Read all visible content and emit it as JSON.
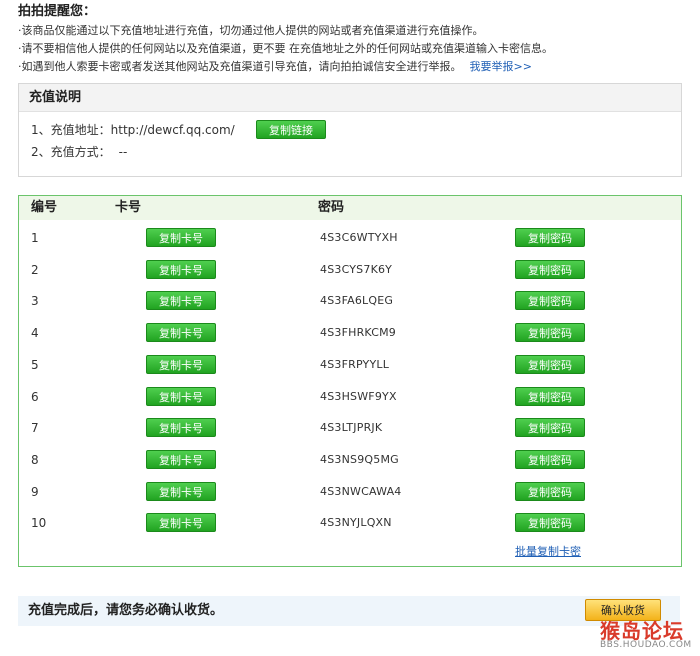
{
  "notice": {
    "title": "拍拍提醒您：",
    "lines": [
      "·该商品仅能通过以下充值地址进行充值，切勿通过他人提供的网站或者充值渠道进行充值操作。",
      "·请不要相信他人提供的任何网站以及充值渠道，更不要 在充值地址之外的任何网站或充值渠道输入卡密信息。",
      "·如遇到他人索要卡密或者发送其他网站及充值渠道引导充值，请向拍拍诚信安全进行举报。"
    ],
    "report_link": "我要举报>>"
  },
  "recharge_info": {
    "title": "充值说明",
    "address_label": "1、充值地址：",
    "address_value": "http://dewcf.qq.com/",
    "copy_link_label": "复制链接",
    "method_label": "2、充值方式：",
    "method_value": "--"
  },
  "cards": {
    "headers": {
      "num": "编号",
      "card": "卡号",
      "pwd": "密码"
    },
    "copy_card_label": "复制卡号",
    "copy_pwd_label": "复制密码",
    "rows": [
      {
        "num": "1",
        "pwd": "4S3C6WTYXH"
      },
      {
        "num": "2",
        "pwd": "4S3CYS7K6Y"
      },
      {
        "num": "3",
        "pwd": "4S3FA6LQEG"
      },
      {
        "num": "4",
        "pwd": "4S3FHRKCM9"
      },
      {
        "num": "5",
        "pwd": "4S3FRPYYLL"
      },
      {
        "num": "6",
        "pwd": "4S3HSWF9YX"
      },
      {
        "num": "7",
        "pwd": "4S3LTJPRJK"
      },
      {
        "num": "8",
        "pwd": "4S3NS9Q5MG"
      },
      {
        "num": "9",
        "pwd": "4S3NWCAWA4"
      },
      {
        "num": "10",
        "pwd": "4S3NYJLQXN"
      }
    ],
    "batch_copy_label": "批量复制卡密"
  },
  "bottom": {
    "text": "充值完成后，请您务必确认收货。",
    "confirm_label": "确认收货"
  },
  "watermark": {
    "logo": "猴岛论坛",
    "url": "BBS.HOUDAO.COM"
  }
}
